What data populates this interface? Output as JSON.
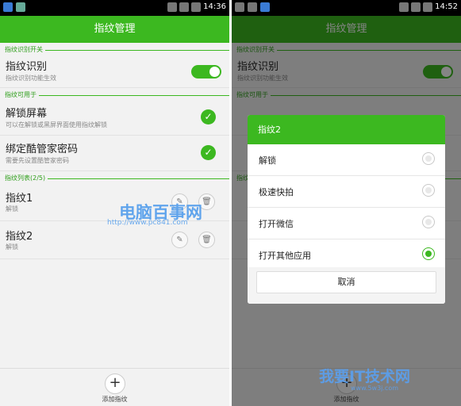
{
  "colors": {
    "accent": "#3cb820",
    "background": "#f2f2f2"
  },
  "screen1": {
    "status": {
      "time": "14:36"
    },
    "appbar_title": "指纹管理",
    "section_switch": "指纹识别开关",
    "fingerprint_recognition": {
      "title": "指纹识别",
      "subtitle": "指纹识别功能生效",
      "enabled": true
    },
    "section_usage": "指纹可用于",
    "unlock_screen": {
      "title": "解锁屏幕",
      "subtitle": "可以在解锁或黑屏界面使用指纹解锁",
      "checked": true
    },
    "bind_password": {
      "title": "绑定酷管家密码",
      "subtitle": "需要先设置酷管家密码",
      "checked": true
    },
    "section_list": "指纹列表(2/5)",
    "fingerprints": [
      {
        "name": "指纹1",
        "action": "解锁"
      },
      {
        "name": "指纹2",
        "action": "解锁"
      }
    ],
    "add_label": "添加指纹",
    "watermark": {
      "text": "电脑百事网",
      "url": "http://www.pc841.com"
    }
  },
  "screen2": {
    "status": {
      "time": "14:52"
    },
    "appbar_title": "指纹管理",
    "section_switch": "指纹识别开关",
    "fingerprint_recognition": {
      "title": "指纹识别",
      "subtitle": "指纹识别功能生效"
    },
    "section_usage": "指纹可用于",
    "section_list": "指纹列表",
    "dialog": {
      "title": "指纹2",
      "options": [
        {
          "label": "解锁",
          "selected": false
        },
        {
          "label": "极速快拍",
          "selected": false
        },
        {
          "label": "打开微信",
          "selected": false
        },
        {
          "label": "打开其他应用",
          "selected": true
        }
      ],
      "cancel_label": "取消"
    },
    "add_label": "添加指纹",
    "watermark": {
      "text": "我要IT技术网",
      "url": "www.5w3j.com"
    }
  }
}
